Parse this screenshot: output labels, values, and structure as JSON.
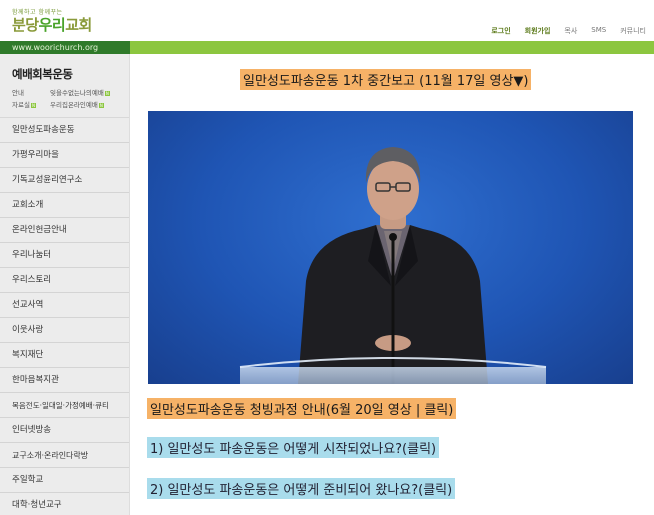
{
  "header": {
    "tagline": "함께하고 함께꾸는",
    "logo_part1": "분당",
    "logo_part2": "우리",
    "logo_part3": "교회",
    "url": "www.woorichurch.org",
    "nav": [
      "로그인",
      "회원가입",
      "목사",
      "SMS",
      "커뮤니티"
    ]
  },
  "sidebar": {
    "title": "예배회복운동",
    "sub_links": [
      "안내",
      "잊을수없는나의예배",
      "자료실",
      "우리집온라인예배"
    ],
    "items": [
      "일만성도파송운동",
      "가평우리마을",
      "기독교성윤리연구소",
      "교회소개",
      "온라인헌금안내",
      "우리나눔터",
      "우리스토리",
      "선교사역",
      "이웃사랑",
      "복지재단",
      "한마음복지관",
      "복음전도·일대일·가정예배·큐티",
      "인터넷방송",
      "교구소개·온라인다락방",
      "주일학교",
      "대학·청년교구"
    ]
  },
  "main": {
    "heading": "일만성도파송운동 1차 중간보고 (11월 17일 영상▼)",
    "link_guide": "일만성도파송운동 청빙과정 안내(6월 20일 영상 | 클릭)",
    "link_q1": "1) 일만성도 파송운동은 어떻게 시작되었나요?(클릭)",
    "link_q2": "2) 일만성도 파송운동은 어떻게 준비되어 왔나요?(클릭)"
  },
  "colors": {
    "header_green": "#8cc63f",
    "url_dark_green": "#2f7a2a",
    "highlight_orange": "#f6b267",
    "highlight_blue": "#a9dcec",
    "video_blue": "#1f55b4"
  }
}
